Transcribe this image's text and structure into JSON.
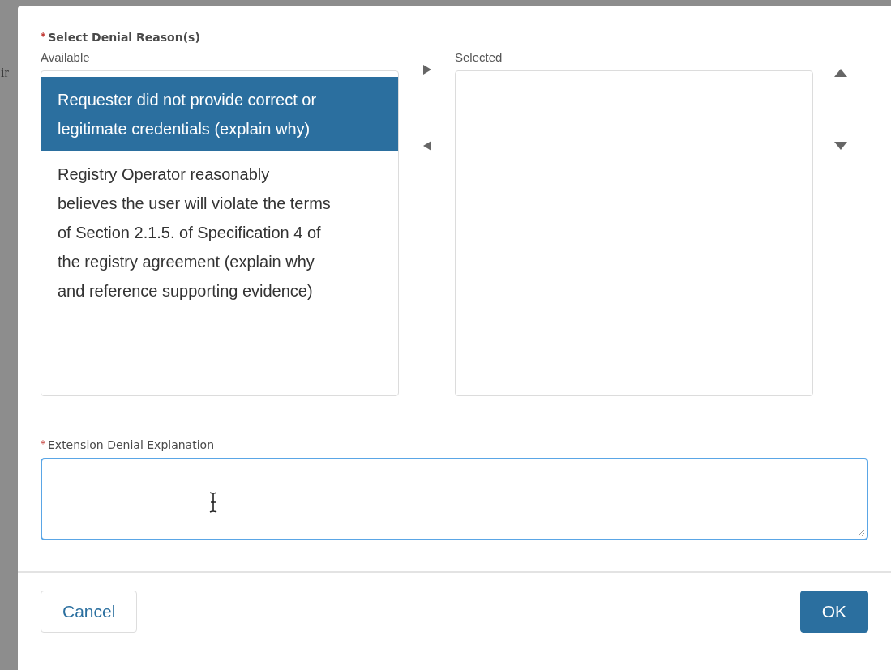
{
  "backdrop_text": "ir",
  "reasons": {
    "required_mark": "*",
    "label": "Select Denial Reason(s)",
    "available": {
      "label": "Available",
      "items": [
        {
          "text": "Requester did not provide correct or legitimate credentials (explain why)",
          "selected": true
        },
        {
          "text": "Registry Operator reasonably believes the user will violate the terms of Section 2.1.5. of Specification 4 of the registry agreement (explain why and reference supporting evidence)",
          "selected": false
        }
      ]
    },
    "selected": {
      "label": "Selected"
    }
  },
  "explanation": {
    "required_mark": "*",
    "label": "Extension Denial Explanation",
    "focused": true
  },
  "buttons": [
    {
      "label": "Cancel",
      "kind": "secondary"
    },
    {
      "label": "OK",
      "kind": "primary"
    }
  ]
}
